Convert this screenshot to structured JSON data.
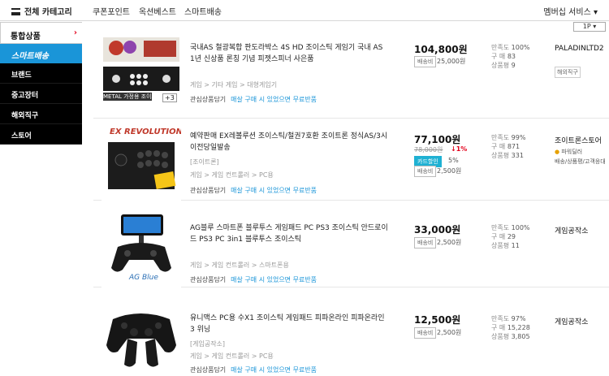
{
  "topnav": {
    "category_label": "전체 카테고리",
    "menu": [
      "쿠폰포인트",
      "옥션베스트",
      "스마트배송"
    ],
    "membership": "멤버십 서비스"
  },
  "sidebar": {
    "header": "통합상품",
    "smart": "스마트배송",
    "items": [
      "브랜드",
      "중고장터",
      "해외직구",
      "스토어"
    ]
  },
  "sort_label": "1P",
  "products": [
    {
      "title": "국내AS 철광복합 판도라박스 4S HD 조이스틱 게임기 국내 AS 1년 신상품 론칭 기념 피젯스피너 사은품",
      "badge": "+3",
      "thumb_caption": "METAL 가정용 조이스틱",
      "crumbs": "게임 > 기타 게임 > 대형게임기",
      "wish": "관심상품담기",
      "offer": "매살 구매 시 있었으면 무료반품",
      "price": "104,800원",
      "ship_tag": "배송비",
      "ship_val": "25,000원",
      "stats": {
        "sat_label": "만족도",
        "sat": "100%",
        "buy_label": "구 매",
        "buy": "83",
        "review_label": "상품평",
        "review": "9"
      },
      "seller": "PALADINLTD2",
      "seller_tag": "해외직구"
    },
    {
      "title": "예약판매 EX레볼루션 조이스틱/철권7호환 조이트론 정식AS/3시이전당일발송",
      "sub": "[조이트론]",
      "crumbs": "게임 > 게임 컨트롤러 > PC용",
      "wish": "관심상품담기",
      "offer": "매살 구매 시 있었으면 무료반품",
      "price": "77,100원",
      "old_price": "78,000원",
      "discount": "↓1%",
      "card_tag": "카드할인",
      "card_val": "5%",
      "ship_tag": "배송비",
      "ship_val": "2,500원",
      "stats": {
        "sat_label": "만족도",
        "sat": "99%",
        "buy_label": "구 매",
        "buy": "871",
        "review_label": "상품평",
        "review": "331"
      },
      "seller": "조이트론스토어",
      "seller_sub1": "파워딜러",
      "seller_sub2": "배송/상품평/고객응대"
    },
    {
      "title": "AG블루 스마트폰 블루투스 게임패드 PC PS3 조이스틱 안드로이드 PS3 PC 3in1 블루투스 조이스틱",
      "crumbs": "게임 > 게임 컨트롤러 > 스마트폰용",
      "wish": "관심상품담기",
      "offer": "매살 구매 시 있었으면 무료반품",
      "price": "33,000원",
      "ship_tag": "배송비",
      "ship_val": "2,500원",
      "stats": {
        "sat_label": "만족도",
        "sat": "100%",
        "buy_label": "구 매",
        "buy": "29",
        "review_label": "상품평",
        "review": "11"
      },
      "seller": "게임공작소"
    },
    {
      "title": "유니맥스 PC용 수X1 조이스틱 게임패드 피파온라인 피파온라인3 위닝",
      "sub": "[게임공작소]",
      "crumbs": "게임 > 게임 컨트롤러 > PC용",
      "wish": "관심상품담기",
      "offer": "매살 구매 시 있었으면 무료반품",
      "price": "12,500원",
      "ship_tag": "배송비",
      "ship_val": "2,500원",
      "stats": {
        "sat_label": "만족도",
        "sat": "97%",
        "buy_label": "구 매",
        "buy": "15,228",
        "review_label": "상품평",
        "review": "3,805"
      },
      "seller": "게임공작소"
    }
  ]
}
